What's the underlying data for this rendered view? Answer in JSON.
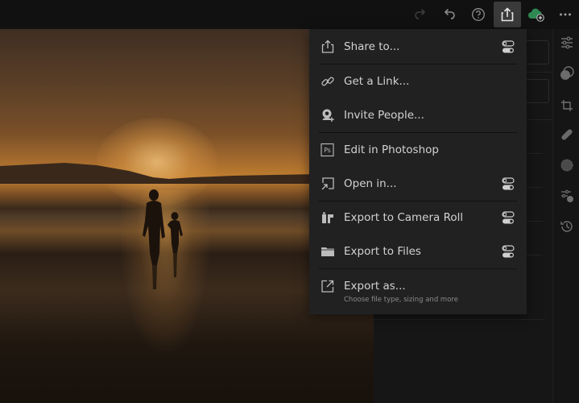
{
  "toolbar": {
    "redo": {
      "icon": "redo-icon",
      "enabled": false
    },
    "undo": {
      "icon": "undo-icon"
    },
    "help": {
      "icon": "help-icon"
    },
    "share": {
      "icon": "share-icon",
      "active": true
    },
    "cloud": {
      "icon": "cloud-add-icon",
      "color": "#2e8a52"
    },
    "more": {
      "icon": "more-icon"
    }
  },
  "share_menu": {
    "items": [
      {
        "label": "Share to...",
        "icon": "share-icon",
        "has_toggle": true
      },
      {
        "label": "Get a Link...",
        "icon": "link-icon",
        "has_toggle": false
      },
      {
        "label": "Invite People...",
        "icon": "invite-person-icon",
        "has_toggle": false
      },
      {
        "label": "Edit in Photoshop",
        "icon": "photoshop-icon",
        "icon_text": "Ps",
        "has_toggle": false
      },
      {
        "label": "Open in...",
        "icon": "open-in-icon",
        "has_toggle": true
      },
      {
        "label": "Export to Camera Roll",
        "icon": "camera-roll-icon",
        "has_toggle": true
      },
      {
        "label": "Export to Files",
        "icon": "folder-icon",
        "has_toggle": true
      },
      {
        "label": "Export as...",
        "sublabel": "Choose file type, sizing and more",
        "icon": "export-as-icon",
        "has_toggle": false
      }
    ]
  },
  "tool_rail": [
    {
      "icon": "edit-sliders-icon"
    },
    {
      "icon": "masking-icon"
    },
    {
      "icon": "crop-rotate-icon"
    },
    {
      "icon": "healing-bandage-icon"
    },
    {
      "icon": "selective-circle-icon"
    },
    {
      "icon": "presets-icon"
    },
    {
      "icon": "history-icon"
    }
  ],
  "photo": {
    "description": "Silhouette of adult and child walking on beach at sunset"
  }
}
